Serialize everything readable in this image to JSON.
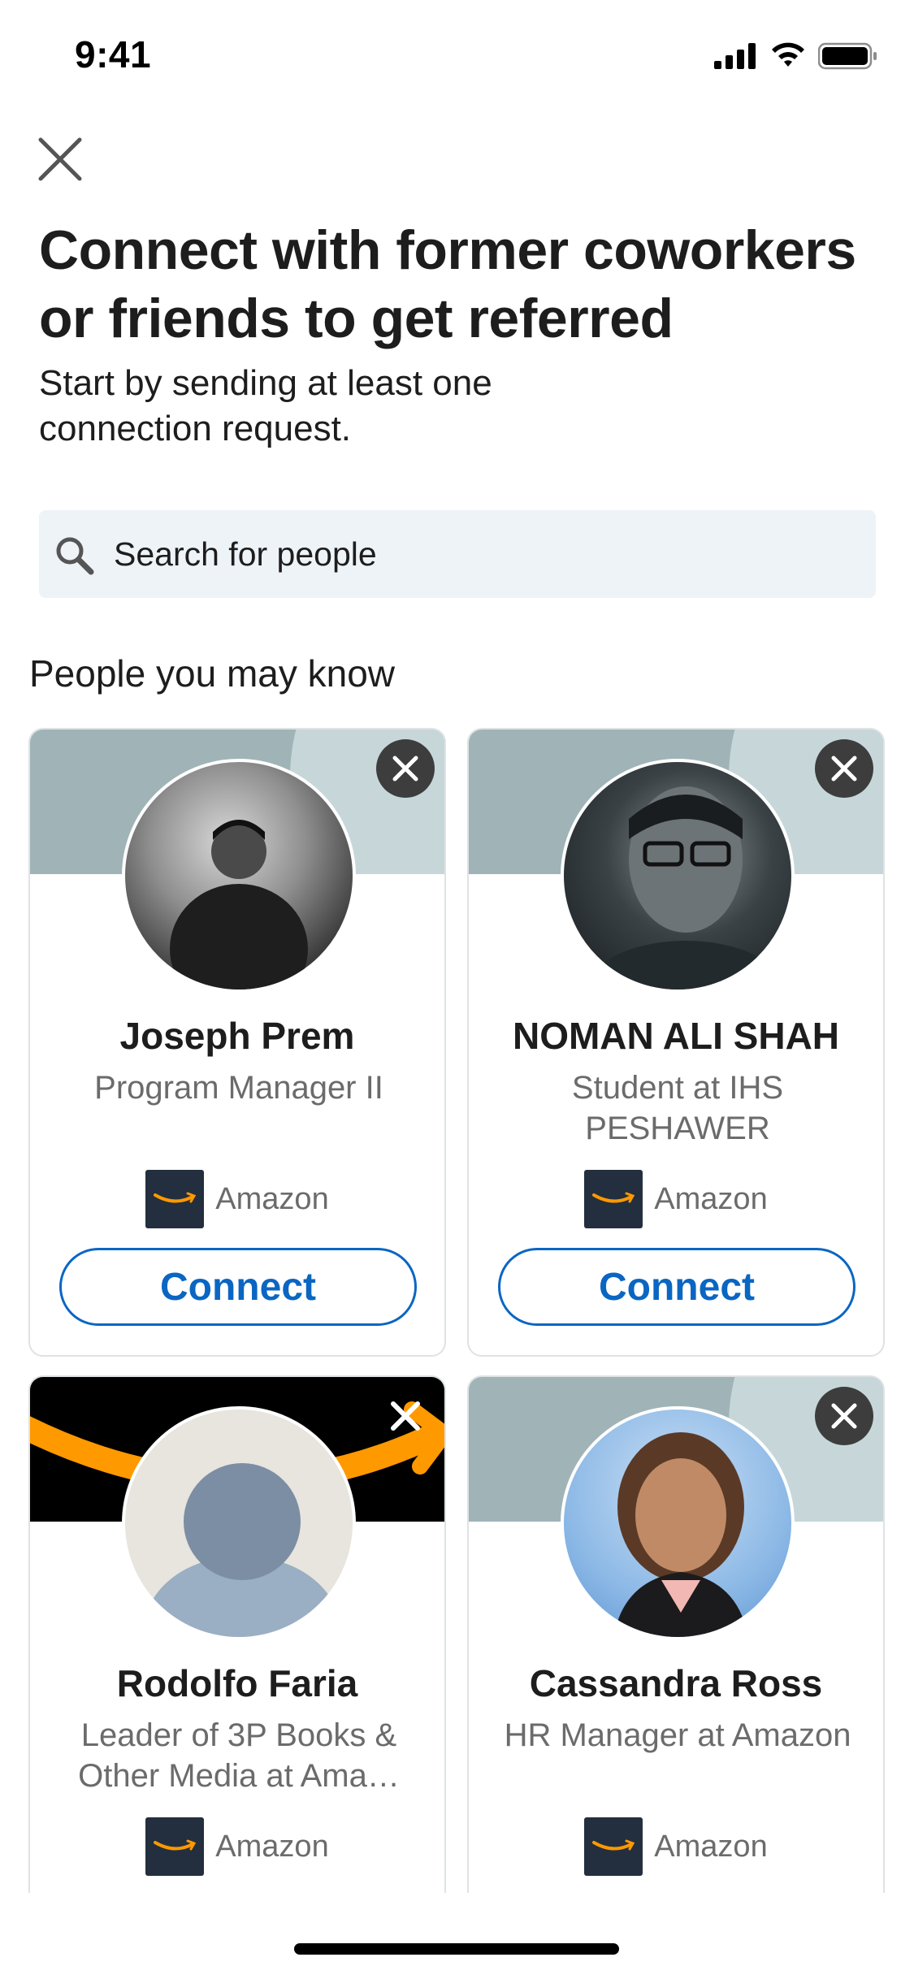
{
  "status_bar": {
    "time": "9:41"
  },
  "header": {
    "title": "Connect with former coworkers or friends to get referred",
    "subtitle": "Start by sending at least one connection request."
  },
  "search": {
    "placeholder": "Search for people"
  },
  "section": {
    "title": "People you may know"
  },
  "people": [
    {
      "name": "Joseph Prem",
      "headline": "Program Manager II",
      "company": "Amazon",
      "action": "Connect"
    },
    {
      "name": "NOMAN ALI SHAH",
      "headline": "Student at IHS PESHAWER",
      "company": "Amazon",
      "action": "Connect"
    },
    {
      "name": "Rodolfo Faria",
      "headline": "Leader of 3P Books & Other Media at Ama…",
      "company": "Amazon"
    },
    {
      "name": "Cassandra Ross",
      "headline": "HR Manager at Amazon",
      "company": "Amazon"
    }
  ],
  "colors": {
    "accent": "#0a66c2",
    "search_bg": "#eef3f8",
    "banner": "#a0b4b7",
    "amazon_logo_bg": "#232f3e",
    "amazon_smile": "#ff9900"
  },
  "icons": [
    "close-icon",
    "search-icon",
    "dismiss-icon",
    "amazon-logo",
    "signal-icon",
    "wifi-icon",
    "battery-icon"
  ]
}
